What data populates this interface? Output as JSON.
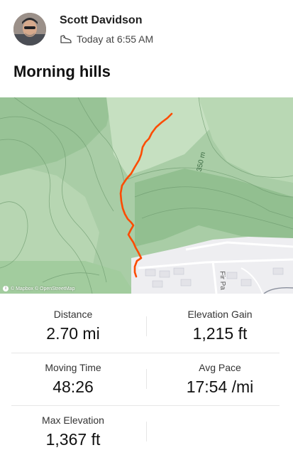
{
  "athlete": {
    "name": "Scott Davidson",
    "activity_icon": "hiking-shoe-icon",
    "time": "Today at 6:55 AM"
  },
  "activity": {
    "title": "Morning hills"
  },
  "map": {
    "contour_label": "350 m",
    "road_label": "Fir Pa",
    "attribution": "© Mapbox © OpenStreetMap",
    "route_color": "#fc4c02"
  },
  "stats": [
    {
      "label": "Distance",
      "value": "2.70 mi"
    },
    {
      "label": "Elevation Gain",
      "value": "1,215 ft"
    },
    {
      "label": "Moving Time",
      "value": "48:26"
    },
    {
      "label": "Avg Pace",
      "value": "17:54 /mi"
    },
    {
      "label": "Max Elevation",
      "value": "1,367 ft"
    }
  ]
}
